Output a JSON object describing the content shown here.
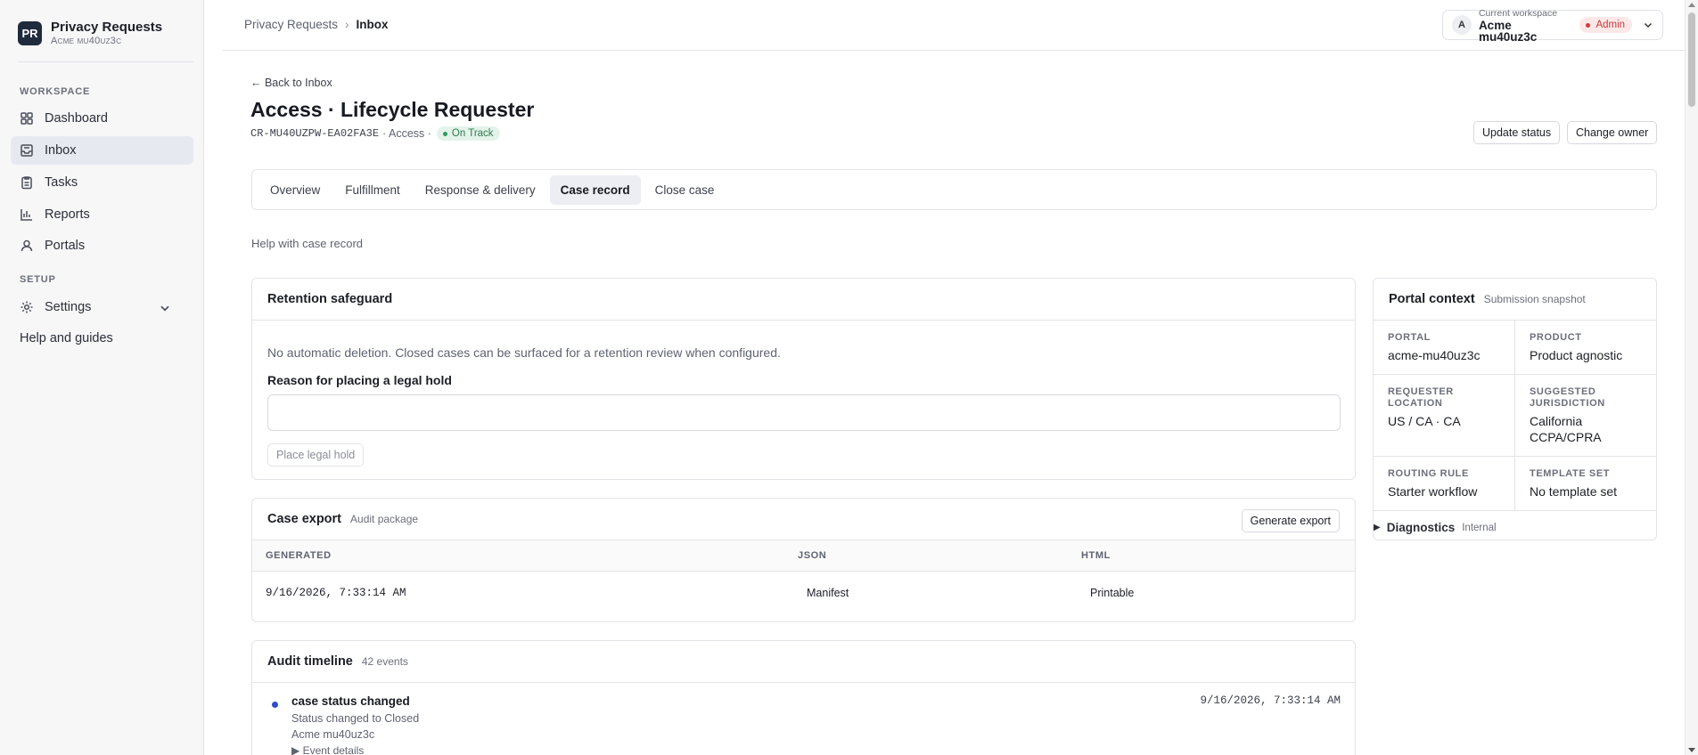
{
  "sidebar": {
    "brand_initials": "PR",
    "brand_name": "Privacy Requests",
    "brand_sub": "Acme mu40uz3c",
    "workspace_section": "WORKSPACE",
    "setup_section": "SETUP",
    "items": [
      {
        "label": "Dashboard",
        "icon": "dashboard-icon"
      },
      {
        "label": "Inbox",
        "icon": "inbox-icon",
        "active": true
      },
      {
        "label": "Tasks",
        "icon": "tasks-icon"
      },
      {
        "label": "Reports",
        "icon": "reports-icon"
      },
      {
        "label": "Portals",
        "icon": "portals-icon"
      }
    ],
    "settings_label": "Settings",
    "help_label": "Help and guides"
  },
  "topbar": {
    "crumb_parent": "Privacy Requests",
    "crumb_sep": "›",
    "crumb_current": "Inbox",
    "workspace_avatar": "A",
    "workspace_label": "Current workspace",
    "workspace_name": "Acme mu40uz3c",
    "role_badge": "Admin"
  },
  "header": {
    "back_label": "← Back to Inbox",
    "title": "Access · Lifecycle Requester",
    "case_id": "CR-MU40UZPW-EA02FA3E",
    "request_type": "· Access ·",
    "status": "On Track",
    "update_status_label": "Update status",
    "change_owner_label": "Change owner"
  },
  "tabs": [
    "Overview",
    "Fulfillment",
    "Response & delivery",
    "Case record",
    "Close case"
  ],
  "active_tab": "Case record",
  "help_text": "Help with case record",
  "retention": {
    "title": "Retention safeguard",
    "description": "No automatic deletion. Closed cases can be surfaced for a retention review when configured.",
    "reason_label": "Reason for placing a legal hold",
    "reason_value": "",
    "button_label": "Place legal hold"
  },
  "export": {
    "title": "Case export",
    "subtitle": "Audit package",
    "button_label": "Generate export",
    "columns": [
      "GENERATED",
      "JSON",
      "HTML"
    ],
    "rows": [
      {
        "generated": "9/16/2026, 7:33:14 AM",
        "json": "Manifest",
        "html": "Printable"
      }
    ]
  },
  "audit": {
    "title": "Audit timeline",
    "count": "42 events",
    "events": [
      {
        "title": "case status changed",
        "detail": "Status changed to Closed",
        "actor": "Acme mu40uz3c",
        "details_label": "▶ Event details",
        "time": "9/16/2026, 7:33:14 AM"
      }
    ]
  },
  "portal_context": {
    "title": "Portal context",
    "subtitle": "Submission snapshot",
    "fields": [
      {
        "key": "PORTAL",
        "value": "acme-mu40uz3c"
      },
      {
        "key": "PRODUCT",
        "value": "Product agnostic"
      },
      {
        "key": "REQUESTER LOCATION",
        "value": "US / CA · CA"
      },
      {
        "key": "SUGGESTED JURISDICTION",
        "value": "California CCPA/CPRA"
      },
      {
        "key": "ROUTING RULE",
        "value": "Starter workflow"
      },
      {
        "key": "TEMPLATE SET",
        "value": "No template set"
      }
    ],
    "diagnostics_label": "Diagnostics",
    "diagnostics_sub": "Internal"
  },
  "colors": {
    "brand": "#1f2a3c",
    "status_green": "#2f7a4c",
    "admin_red": "#c43b3b",
    "timeline_dot": "#2e4fc7"
  }
}
